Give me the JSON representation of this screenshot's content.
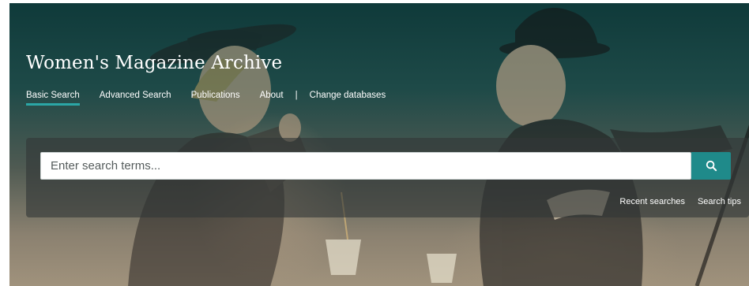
{
  "header": {
    "title": "Women's Magazine Archive"
  },
  "nav": {
    "items": [
      {
        "label": "Basic Search",
        "active": true
      },
      {
        "label": "Advanced Search"
      },
      {
        "label": "Publications"
      },
      {
        "label": "About"
      }
    ],
    "separator": "|",
    "change_db": "Change databases"
  },
  "search": {
    "placeholder": "Enter search terms..."
  },
  "links": {
    "recent": "Recent searches",
    "tips": "Search tips"
  },
  "icons": {
    "search_button": "search-icon"
  },
  "colors": {
    "accent": "#1f8a8a",
    "active_underline": "#2ba6a6",
    "header_bg": "#0f3a3a"
  }
}
